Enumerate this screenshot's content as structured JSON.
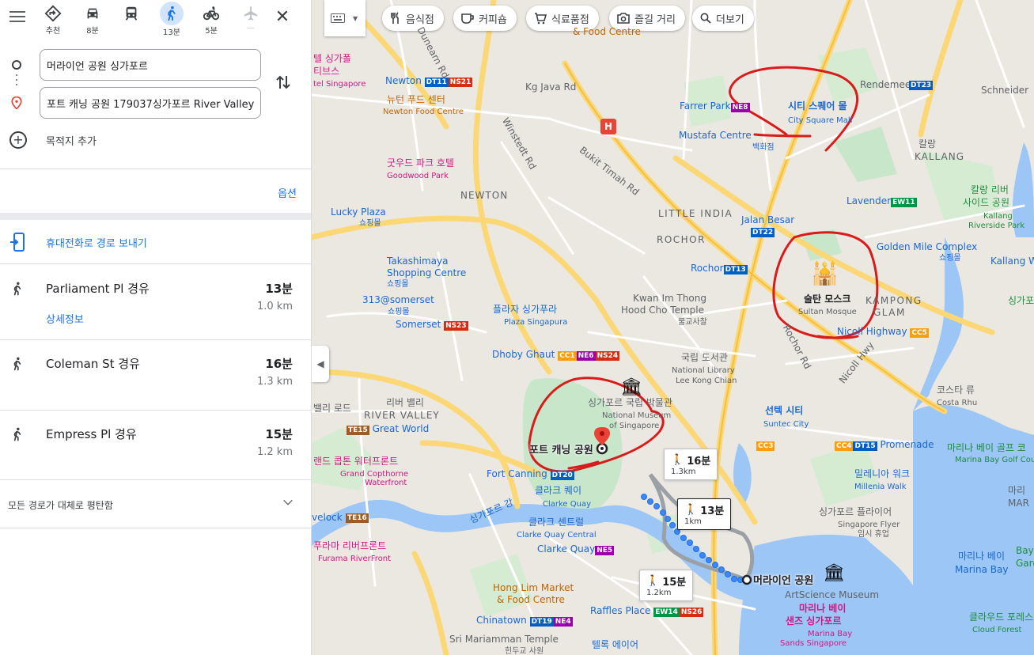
{
  "sidebar": {
    "modes": [
      {
        "name": "best",
        "label": "추천",
        "icon": "directions-diamond-icon"
      },
      {
        "name": "driving",
        "label": "8분",
        "icon": "car-icon"
      },
      {
        "name": "transit",
        "label": "",
        "icon": "train-icon"
      },
      {
        "name": "walking",
        "label": "13분",
        "icon": "walk-icon",
        "active": true
      },
      {
        "name": "cycling",
        "label": "5분",
        "icon": "bicycle-icon"
      },
      {
        "name": "flight",
        "label": "—",
        "icon": "airplane-icon",
        "disabled": true
      }
    ],
    "origin": "머라이언 공원 싱가포르",
    "destination": "포트 캐닝 공원 179037싱가포르 River Valley",
    "add_destination": "목적지 추가",
    "options_label": "옵션",
    "send_to_phone": "휴대전화로 경로 보내기",
    "routes": [
      {
        "name": "Parliament Pl 경유",
        "time": "13분",
        "distance": "1.0 km",
        "detail": "상세정보"
      },
      {
        "name": "Coleman St 경유",
        "time": "16분",
        "distance": "1.3 km"
      },
      {
        "name": "Empress Pl 경유",
        "time": "15분",
        "distance": "1.2 km"
      }
    ],
    "flat_note": "모든 경로가 대체로 평탄함"
  },
  "map": {
    "chips": [
      {
        "label": "음식점",
        "icon": "fork-knife-icon"
      },
      {
        "label": "커피숍",
        "icon": "coffee-cup-icon"
      },
      {
        "label": "식료품점",
        "icon": "shopping-cart-icon"
      },
      {
        "label": "즐길 거리",
        "icon": "camera-icon"
      },
      {
        "label": "더보기",
        "icon": "search-icon"
      }
    ],
    "labels": {
      "dunearn": "Dunearn Rd",
      "newton_station": "Newton",
      "newton_food_ko": "뉴턴 푸드 센터",
      "newton_food_en": "Newton Food Centre",
      "goodwood_ko": "굿우드 파크 호텔",
      "goodwood_en": "Goodwood Park",
      "newton_area": "NEWTON",
      "lucky_ko": "Lucky Plaza",
      "lucky_en": "쇼핑몰",
      "taka_ko": "Takashimaya",
      "taka_ko2": "Shopping Centre",
      "taka_en": "쇼핑몰",
      "s313": "313@somerset",
      "s313_en": "쇼핑몰",
      "somerset": "Somerset",
      "plaza_ko": "플라자 싱가푸라",
      "plaza_en": "Plaza Singapura",
      "dhoby": "Dhoby Ghaut",
      "farrer": "Farrer Park",
      "city_square_ko": "시티 스퀘어 몰",
      "city_square_en": "City Square Mall",
      "mustafa": "Mustafa Centre",
      "mustafa_en": "백화점",
      "bukit": "Bukit Timah Rd",
      "little_india": "LITTLE INDIA",
      "rochor_area": "ROCHOR",
      "rochor_station": "Rochor",
      "jalan_besar": "Jalan Besar",
      "kwan_ko": "Kwan Im Thong",
      "kwan_ko2": "Hood Cho Temple",
      "kwan_en": "불교사찰",
      "kallang_ko": "칼랑",
      "kallang_en": "KALLANG",
      "lavender": "Lavender",
      "kallang_river_ko": "칼랑 리버",
      "kallang_river_ko2": "사이드 공원",
      "kallang_river_en": "Kallang",
      "kallang_river_en2": "Riverside Park",
      "golden_mile": "Golden Mile Complex",
      "golden_mile_en": "쇼핑몰",
      "sultan_ko": "술탄 모스크",
      "sultan_en": "Sultan Mosque",
      "kampong": "KAMPONG",
      "glam": "GLAM",
      "rochor_rd": "Rochor Rd",
      "nicoll": "Nicoll Highway",
      "nicoll_hwy": "Nicoll Hwy",
      "library_ko": "국립 도서관",
      "library_en": "National Library",
      "library_en2": "Lee Kong Chian",
      "museum_ko": "싱가포르 국립 박물관",
      "museum_en": "National Museum",
      "museum_en2": "of Singapore",
      "river_valley_ko": "리버 밸리",
      "river_valley_en": "RIVER VALLEY",
      "great_world": "Great World",
      "fort_canning_park": "포트 캐닝 공원",
      "fort_canning_st": "Fort Canning",
      "clarke_ko": "클라크 퀘이",
      "clarke_en": "Clarke Quay",
      "clarke_central_ko": "클라크 센트럴",
      "clarke_central_en": "Clarke Quay Central",
      "clarke_quay_st": "Clarke Quay",
      "suntec_ko": "선텍 시티",
      "suntec_en": "Suntec City",
      "promenade": "Promenade",
      "costa_ko": "코스타 류",
      "costa_en": "Costa Rhu",
      "marina_golf_ko": "마리나 베이 골프 코",
      "marina_golf_en": "Marina Bay Golf Cou",
      "millenia_ko": "밀레니아 워크",
      "millenia_en": "Millenia Walk",
      "flyer_ko": "싱가포르 플라이어",
      "flyer_en": "Singapore Flyer",
      "flyer_en2": "임시 휴업",
      "merlion_park": "머라이언 공원",
      "artscience": "ArtScience Museum",
      "mbs_ko": "마리나 베이",
      "mbs_ko2": "샌즈 싱가포르",
      "mbs_en": "Marina Bay",
      "mbs_en2": "Sands Singapore",
      "marina_bay_ko": "마리나 베이",
      "marina_bay_en": "Marina Bay",
      "cloud_forest_ko": "클라우드 포레스트",
      "cloud_forest_en": "Cloud Forest",
      "hong_lim_ko": "Hong Lim Market",
      "hong_lim_en": "& Food Centre",
      "raffles": "Raffles Place",
      "chinatown": "Chinatown",
      "sri_mariamman": "Sri Mariamman Temple",
      "sri_mariamman_en": "힌두교 사원",
      "telok": "텔록 에이어",
      "grand_copthorne_ko": "랜드 콥톤 워터프론트",
      "grand_copthorne_en": "Grand Copthorne",
      "grand_copthorne_en2": "Waterfront",
      "furama_ko": "푸라마 리버프론트",
      "furama_en": "Furama RiverFront",
      "singapore_river": "싱가포르 강",
      "havelock": "velock",
      "valley_rd": "밸리 로드",
      "kg_java": "Kg Java Rd",
      "winstedt": "Winstedt Rd",
      "schneider": "Schneider",
      "rendemeer": "Rendemeer",
      "kallang_way": "Kallang Wa",
      "singapore_top": "싱가포",
      "marina_east": "마리",
      "mar": "MAR",
      "bay_east": "Bay",
      "garden": "Gard",
      "hotel_top1": "텔 싱가폴",
      "hotel_top2": "티브스",
      "hotel_top3": "tel Singapore",
      "food_centre_top": "& Food Centre",
      "hospital_label": "H"
    },
    "stations": [
      {
        "code": "DT11",
        "color": "#005ec4"
      },
      {
        "code": "NS21",
        "color": "#d42e12"
      },
      {
        "code": "NE8",
        "color": "#9900aa"
      },
      {
        "code": "DT23",
        "color": "#005ec4"
      },
      {
        "code": "EW11",
        "color": "#009645"
      },
      {
        "code": "DT22",
        "color": "#005ec4"
      },
      {
        "code": "DT13",
        "color": "#005ec4"
      },
      {
        "code": "NS23",
        "color": "#d42e12"
      },
      {
        "code": "CC1",
        "color": "#fa9e0d"
      },
      {
        "code": "NE6",
        "color": "#9900aa"
      },
      {
        "code": "NS24",
        "color": "#d42e12"
      },
      {
        "code": "CC5",
        "color": "#fa9e0d"
      },
      {
        "code": "TE15",
        "color": "#9d5b25"
      },
      {
        "code": "DT20",
        "color": "#005ec4"
      },
      {
        "code": "CC3",
        "color": "#fa9e0d"
      },
      {
        "code": "CC4",
        "color": "#fa9e0d"
      },
      {
        "code": "DT15",
        "color": "#005ec4"
      },
      {
        "code": "NE5",
        "color": "#9900aa"
      },
      {
        "code": "TE16",
        "color": "#9d5b25"
      },
      {
        "code": "EW14",
        "color": "#009645"
      },
      {
        "code": "NS26",
        "color": "#d42e12"
      },
      {
        "code": "DT19",
        "color": "#005ec4"
      },
      {
        "code": "NE4",
        "color": "#9900aa"
      }
    ],
    "route_boxes": [
      {
        "time": "16분",
        "dist": "1.3km"
      },
      {
        "time": "13분",
        "dist": "1km"
      },
      {
        "time": "15분",
        "dist": "1.2km"
      }
    ],
    "annotation_color": "#d81b1b",
    "route_color": "#1a73e8"
  }
}
